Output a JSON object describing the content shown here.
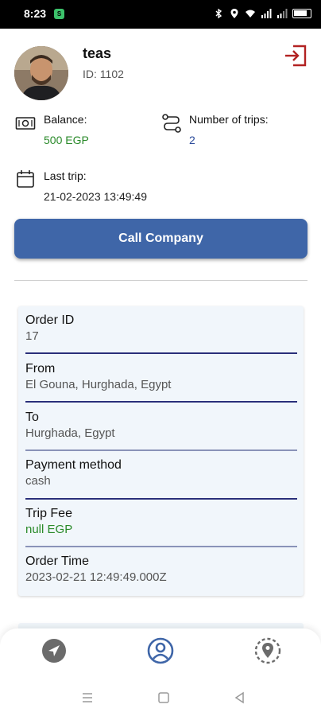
{
  "status_bar": {
    "time": "8:23",
    "app_badge": "S"
  },
  "profile": {
    "name": "teas",
    "id_text": "ID: 1102"
  },
  "stats": {
    "balance_label": "Balance:",
    "balance_value": "500 EGP",
    "trips_label": "Number of trips:",
    "trips_value": "2",
    "last_trip_label": "Last trip:",
    "last_trip_value": "21-02-2023 13:49:49"
  },
  "call_button": {
    "label": "Call Company"
  },
  "order": {
    "fields": [
      {
        "label": "Order ID",
        "value": "17"
      },
      {
        "label": "From",
        "value": "El Gouna, Hurghada, Egypt"
      },
      {
        "label": "To",
        "value": "Hurghada, Egypt"
      },
      {
        "label": "Payment method",
        "value": "cash"
      },
      {
        "label": "Trip Fee",
        "value": "null EGP"
      },
      {
        "label": "Order Time",
        "value": "2023-02-21 12:49:49.000Z"
      }
    ]
  },
  "colors": {
    "primary": "#3f66a8",
    "balance_green": "#2a8a2a",
    "trips_blue": "#2b4b9a",
    "logout_red": "#b22222",
    "card_bg": "#f1f6fb",
    "rule_dark": "#2a2f7a",
    "rule_light": "#8a93b8"
  },
  "icons": {
    "logout": "logout-icon",
    "balance": "money-icon",
    "trips": "route-icon",
    "last_trip": "calendar-icon",
    "nav_navigate": "navigation-icon",
    "nav_profile": "profile-icon",
    "nav_location": "location-pin-icon"
  }
}
